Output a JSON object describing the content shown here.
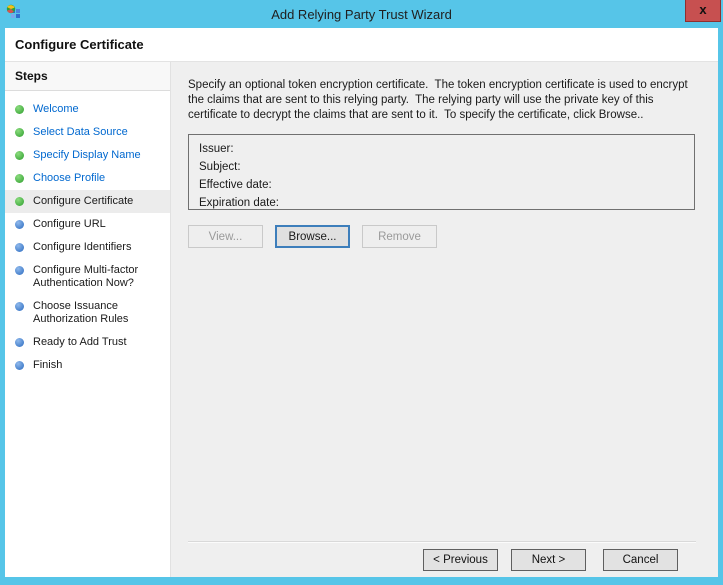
{
  "window": {
    "title": "Add Relying Party Trust Wizard",
    "close_label": "x",
    "page_header": "Configure Certificate"
  },
  "sidebar": {
    "heading": "Steps",
    "items": [
      {
        "label": "Welcome",
        "state": "completed"
      },
      {
        "label": "Select Data Source",
        "state": "completed"
      },
      {
        "label": "Specify Display Name",
        "state": "completed"
      },
      {
        "label": "Choose Profile",
        "state": "completed"
      },
      {
        "label": "Configure Certificate",
        "state": "current"
      },
      {
        "label": "Configure URL",
        "state": "upcoming"
      },
      {
        "label": "Configure Identifiers",
        "state": "upcoming"
      },
      {
        "label": "Configure Multi-factor Authentication Now?",
        "state": "upcoming"
      },
      {
        "label": "Choose Issuance Authorization Rules",
        "state": "upcoming"
      },
      {
        "label": "Ready to Add Trust",
        "state": "upcoming"
      },
      {
        "label": "Finish",
        "state": "upcoming"
      }
    ]
  },
  "main": {
    "description": "Specify an optional token encryption certificate.  The token encryption certificate is used to encrypt the claims that are sent to this relying party.  The relying party will use the private key of this certificate to decrypt the claims that are sent to it.  To specify the certificate, click Browse..",
    "certificate_fields": [
      {
        "label": "Issuer:",
        "value": ""
      },
      {
        "label": "Subject:",
        "value": ""
      },
      {
        "label": "Effective date:",
        "value": ""
      },
      {
        "label": "Expiration date:",
        "value": ""
      }
    ],
    "buttons": {
      "view": "View...",
      "browse": "Browse...",
      "remove": "Remove"
    }
  },
  "footer": {
    "previous": "< Previous",
    "next": "Next >",
    "cancel": "Cancel"
  },
  "colors": {
    "titlebar": "#56c5e8",
    "close_button": "#c75050",
    "completed_step_text": "#0068cf",
    "bullet_completed": "#2e9e2e",
    "bullet_upcoming": "#2b6bc0",
    "main_background": "#efefef",
    "focus_border": "#3d7ebb"
  }
}
